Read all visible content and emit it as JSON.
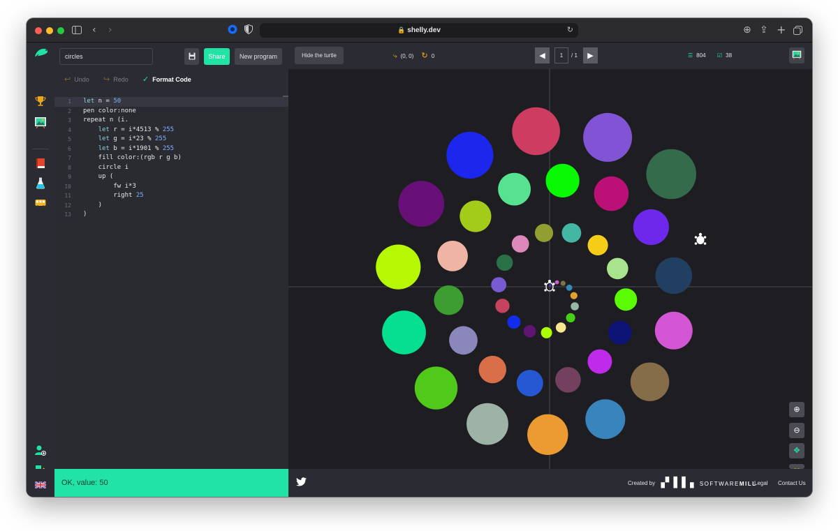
{
  "browser": {
    "url": "shelly.dev",
    "back_icon": "chevron-left-icon",
    "forward_icon": "chevron-right-icon"
  },
  "rail": {
    "logo_icon": "turtle-logo-icon",
    "items": [
      {
        "name": "trophy-icon",
        "color": "#e8a81c"
      },
      {
        "name": "gallery-easel-icon",
        "color": "#2bd4a0"
      },
      {
        "name": "book-icon",
        "color": "#e2452c"
      },
      {
        "name": "flask-icon",
        "color": "#22c7e8"
      },
      {
        "name": "bus-icon",
        "color": "#f2b51d"
      }
    ],
    "bottom": [
      "add-user-icon",
      "logout-icon"
    ],
    "language": "uk-flag-icon"
  },
  "editor": {
    "program_name": "circles",
    "save_icon": "save-disk-icon",
    "share_label": "Share",
    "new_program_label": "New program",
    "undo_label": "Undo",
    "redo_label": "Redo",
    "format_label": "Format Code",
    "code_lines": [
      {
        "n": "1",
        "text": "let n = 50"
      },
      {
        "n": "2",
        "text": "pen color:none"
      },
      {
        "n": "3",
        "text": "repeat n (i."
      },
      {
        "n": "4",
        "text": "    let r = i*4513 % 255"
      },
      {
        "n": "5",
        "text": "    let g = i*23 % 255"
      },
      {
        "n": "6",
        "text": "    let b = i*1901 % 255"
      },
      {
        "n": "7",
        "text": "    fill color:(rgb r g b)"
      },
      {
        "n": "8",
        "text": "    circle i"
      },
      {
        "n": "9",
        "text": "    up ("
      },
      {
        "n": "10",
        "text": "        fw i*3"
      },
      {
        "n": "11",
        "text": "        right 25"
      },
      {
        "n": "12",
        "text": "    )"
      },
      {
        "n": "13",
        "text": ")"
      }
    ],
    "status": "OK, value: 50"
  },
  "canvas_toolbar": {
    "hide_turtle_label": "Hide the turtle",
    "position_text": "(0, 0)",
    "angle_text": "0",
    "page_current": "1",
    "page_total": "/ 1",
    "stat_lines": "804",
    "stat_steps": "38"
  },
  "zoom_controls": [
    "zoom-in-icon",
    "zoom-out-icon",
    "center-turtle-icon",
    "fit-screen-icon"
  ],
  "footer": {
    "created_by": "Created by",
    "brand_prefix": "SOFTWARE",
    "brand_suffix": "MILL",
    "legal": "Legal",
    "contact": "Contact Us"
  },
  "drawing": {
    "program": {
      "count": 50,
      "r_mult": 4513,
      "g_mult": 23,
      "b_mult": 1901,
      "forward_mult": 3,
      "turn_deg": 25
    }
  }
}
